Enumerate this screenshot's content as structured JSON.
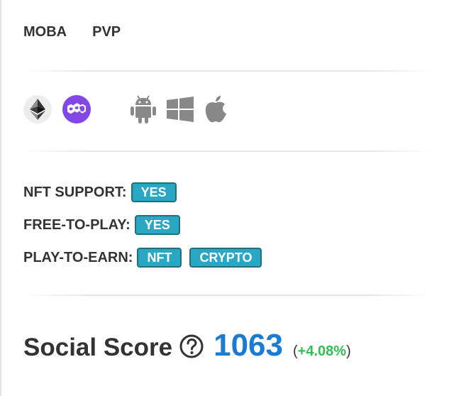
{
  "genres": [
    "MOBA",
    "PVP"
  ],
  "chains": [
    {
      "name": "ethereum-icon",
      "color": "#ededed"
    },
    {
      "name": "polygon-icon",
      "color": "#8247e5"
    }
  ],
  "platforms": [
    "android-icon",
    "windows-icon",
    "apple-icon"
  ],
  "features": [
    {
      "label": "NFT SUPPORT:",
      "badges": [
        "YES"
      ]
    },
    {
      "label": "FREE-TO-PLAY:",
      "badges": [
        "YES"
      ]
    },
    {
      "label": "PLAY-TO-EARN:",
      "badges": [
        "NFT",
        "CRYPTO"
      ]
    }
  ],
  "social": {
    "label": "Social Score",
    "score": "1063",
    "change_open": "(",
    "change": "+4.08%",
    "change_close": ")"
  },
  "colors": {
    "badge_bg": "#2aa7c2",
    "badge_border": "#1f6f7d",
    "score": "#1a7bd4",
    "change": "#2fbf55"
  }
}
